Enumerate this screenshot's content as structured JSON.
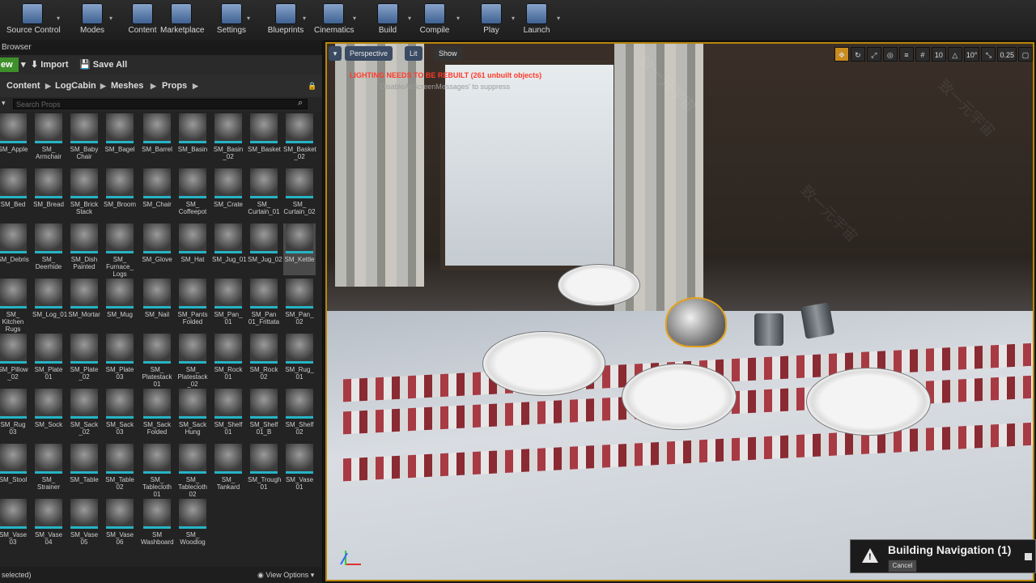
{
  "toolbar": {
    "buttons": [
      {
        "label": "Source Control",
        "icon": "source-control-icon"
      },
      {
        "label": "Modes",
        "icon": "modes-icon"
      },
      {
        "label": "Content",
        "icon": "content-icon"
      },
      {
        "label": "Marketplace",
        "icon": "marketplace-icon"
      },
      {
        "label": "Settings",
        "icon": "settings-icon"
      },
      {
        "label": "Blueprints",
        "icon": "blueprints-icon"
      },
      {
        "label": "Cinematics",
        "icon": "cinematics-icon"
      },
      {
        "label": "Build",
        "icon": "build-icon"
      },
      {
        "label": "Compile",
        "icon": "compile-icon"
      },
      {
        "label": "Play",
        "icon": "play-icon"
      },
      {
        "label": "Launch",
        "icon": "launch-icon"
      }
    ]
  },
  "content_browser": {
    "tab_title": "Browser",
    "add_new_label": "ew",
    "import_label": "Import",
    "save_all_label": "Save All",
    "breadcrumbs": [
      "Content",
      "LogCabin",
      "Meshes",
      "Props"
    ],
    "search_placeholder": "Search Props",
    "status_text": "selected)",
    "view_options_label": "View Options",
    "assets": [
      [
        "SM_Apple",
        "SM_\nArmchair",
        "SM_Baby\nChair",
        "SM_Bagel",
        "SM_Barrel",
        "SM_Basin",
        "SM_Basin\n_02",
        "SM_Basket",
        "SM_Basket\n_02"
      ],
      [
        "SM_Bed",
        "SM_Bread",
        "SM_Brick\nStack",
        "SM_Broom",
        "SM_Chair",
        "SM_\nCoffeepot",
        "SM_Crate",
        "SM_\nCurtain_01",
        "SM_\nCurtain_02"
      ],
      [
        "SM_Debris",
        "SM_\nDeerhide",
        "SM_Dish\nPainted",
        "SM_\nFurnace_\nLogs",
        "SM_Glove",
        "SM_Hat",
        "SM_Jug_01",
        "SM_Jug_02",
        "SM_Kettle"
      ],
      [
        "SM_\nKitchen\nRugs",
        "SM_Log_01",
        "SM_Mortar",
        "SM_Mug",
        "SM_Nail",
        "SM_Pants\nFolded",
        "SM_Pan_\n01",
        "SM_Pan\n01_Frittata",
        "SM_Pan_\n02"
      ],
      [
        "SM_Pillow\n_02",
        "SM_Plate\n01",
        "SM_Plate\n_02",
        "SM_Plate\n03",
        "SM_\nPlatestack\n01",
        "SM_\nPlatestack\n_02",
        "SM_Rock\n01",
        "SM_Rock\n02",
        "SM_Rug_\n01"
      ],
      [
        "SM_Rug\n03",
        "SM_Sock",
        "SM_Sack\n_02",
        "SM_Sack\n03",
        "SM_Sack\nFolded",
        "SM_Sack\nHung",
        "SM_Shelf\n01",
        "SM_Shelf\n01_B",
        "SM_Shelf\n02"
      ],
      [
        "SM_Stool",
        "SM_\nStrainer",
        "SM_Table",
        "SM_Table\n02",
        "SM_\nTablecloth\n01",
        "SM_\nTablecloth\n02",
        "SM_\nTankard",
        "SM_Trough\n01",
        "SM_Vase\n01"
      ],
      [
        "SM_Vase\n03",
        "SM_Vase\n04",
        "SM_Vase\n05",
        "SM_Vase\n06",
        "SM\nWashboard",
        "SM_\nWoodlog"
      ]
    ],
    "selected_asset": "SM_Kettle"
  },
  "viewport": {
    "perspective_label": "Perspective",
    "lit_label": "Lit",
    "show_label": "Show",
    "warning_text": "LIGHTING NEEDS TO BE REBUILT (261 unbuilt objects)",
    "warning_hint": "'DisableAllScreenMessages' to suppress",
    "grid_snap_value": "10",
    "rotation_snap_value": "10°",
    "scale_snap_value": "0.25"
  },
  "notification": {
    "title": "Building Navigation (1)",
    "cancel_label": "Cancel"
  },
  "watermark_text": "致一元宇宙"
}
